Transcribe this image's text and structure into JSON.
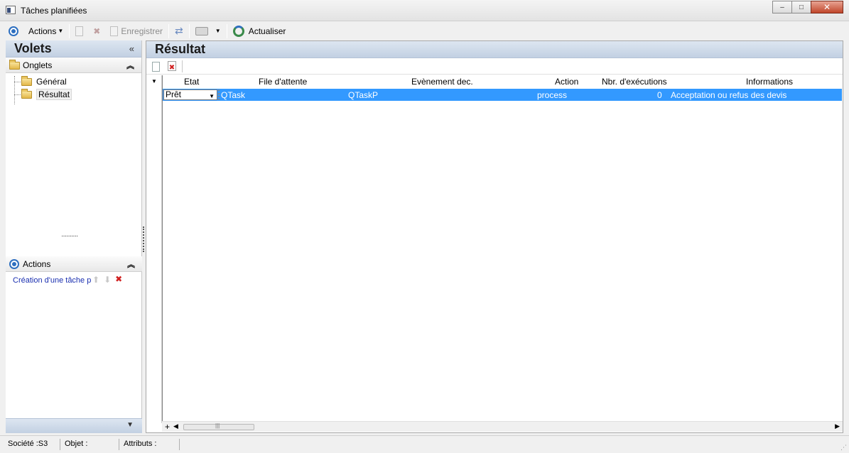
{
  "window": {
    "title": "Tâches planifiées",
    "minimize": "–",
    "maximize": "□",
    "close": "✕"
  },
  "toolbar": {
    "actions_label": "Actions",
    "save_label": "Enregistrer",
    "refresh_label": "Actualiser"
  },
  "left_pane": {
    "title": "Volets",
    "collapse_glyph": "«",
    "tabs_section": {
      "title": "Onglets",
      "items": [
        {
          "label": "Général"
        },
        {
          "label": "Résultat"
        }
      ]
    },
    "actions_section": {
      "title": "Actions",
      "items": [
        {
          "label": "Création d'une tâche p"
        }
      ]
    }
  },
  "right_pane": {
    "title": "Résultat",
    "columns": [
      "Etat",
      "File d'attente",
      "Evènement dec.",
      "Action",
      "Nbr. d'exécutions",
      "Informations"
    ],
    "rows": [
      {
        "etat": "Prêt",
        "queue": "QTask",
        "event": "QTaskP",
        "action": "process",
        "executions": "0",
        "info": "Acceptation ou refus des devis"
      }
    ]
  },
  "statusbar": {
    "societe": "Société :S3",
    "objet": "Objet :",
    "attributs": "Attributs :"
  },
  "colors": {
    "selection": "#3399ff",
    "pane_header": "#c2d0e2",
    "link": "#1a2fb0"
  }
}
